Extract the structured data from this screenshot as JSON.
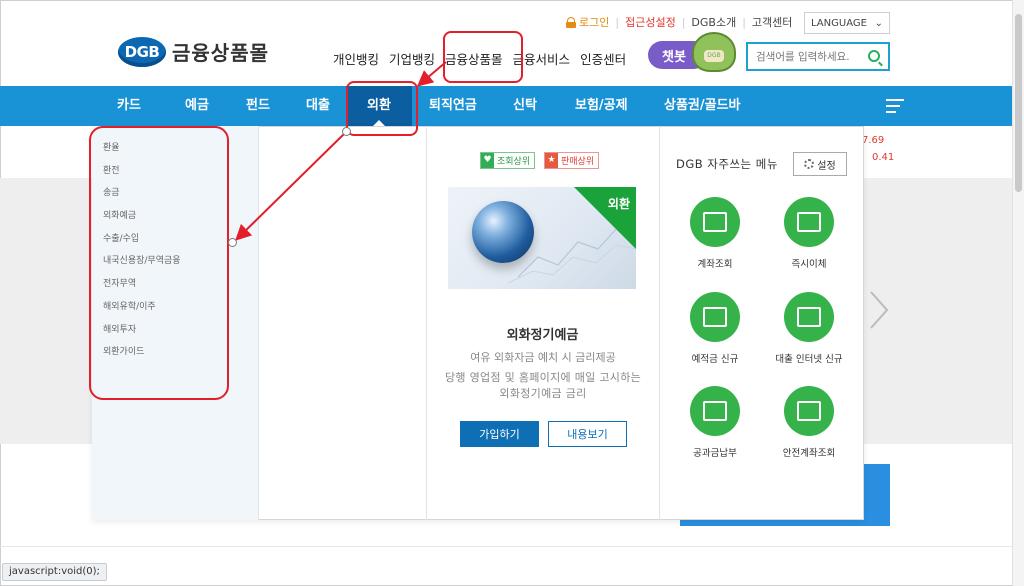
{
  "header": {
    "logo_badge": "DGB",
    "logo_text": "금융상품몰",
    "util": {
      "login": "로그인",
      "accessibility": "접근성설정",
      "dgb_intro": "DGB소개",
      "customer_center": "고객센터",
      "language": "LANGUAGE"
    },
    "top_nav": [
      "개인뱅킹",
      "기업뱅킹",
      "금융상품몰",
      "금융서비스",
      "인증센터"
    ],
    "chatbot": "챗봇",
    "chatbot_mascot_text": "DGB",
    "search_placeholder": "검색어를 입력하세요."
  },
  "gnb": {
    "items": [
      "카드",
      "예금",
      "펀드",
      "대출",
      "외환",
      "퇴직연금",
      "신탁",
      "보험/공제",
      "상품권/골드바"
    ],
    "active": "외환"
  },
  "submenu": [
    "환율",
    "환전",
    "송금",
    "외화예금",
    "수출/수입",
    "내국신용장/무역금융",
    "전자무역",
    "해외유학/이주",
    "해외투자",
    "외환가이드"
  ],
  "product": {
    "chip_views": "조회상위",
    "chip_sales": "판매상위",
    "corner_label": "외환",
    "title": "외화정기예금",
    "desc": "여유 외화자금 예치 시 금리제공",
    "desc2": "당행 영업점 및 홈페이지에 매일 고시하는 외화정기예금 금리",
    "join_button": "가입하기",
    "view_button": "내용보기"
  },
  "favorites": {
    "title": "DGB 자주쓰는 메뉴",
    "settings_button": "설정",
    "items": [
      "계좌조회",
      "즉시이체",
      "예적금 신규",
      "대출 인터넷 신규",
      "공과금납부",
      "안전계좌조회"
    ]
  },
  "background": {
    "rate_1": "7.69",
    "rate_2": "0.41"
  },
  "status_bar": "javascript:void(0);",
  "colors": {
    "brand_blue": "#1a93d6",
    "active_blue": "#0b5e9f",
    "quick_green": "#35b24a",
    "annotation_red": "#e21f2a"
  }
}
